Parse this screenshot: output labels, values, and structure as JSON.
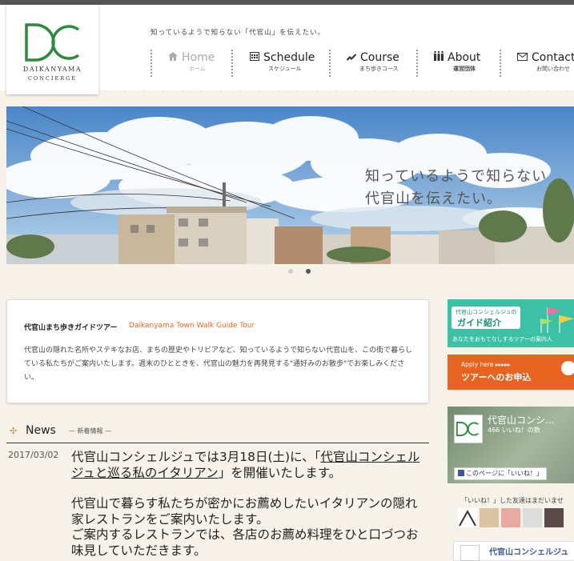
{
  "logo": {
    "line1": "DAIKANYAMA",
    "line2": "CONCIERGE",
    "color": "#2d8a3e"
  },
  "header": {
    "tagline": "知っているようで知らない「代官山」を伝えたい。"
  },
  "nav": [
    {
      "label": "Home",
      "sub": "ホーム",
      "icon": "home-icon",
      "active": true
    },
    {
      "label": "Schedule",
      "sub": "スケジュール",
      "icon": "calendar-icon"
    },
    {
      "label": "Course",
      "sub": "まち歩きコース",
      "icon": "walk-icon"
    },
    {
      "label": "About",
      "sub": "運営団体",
      "icon": "group-icon"
    },
    {
      "label": "Contact",
      "sub": "お問い合わせ",
      "icon": "mail-icon"
    }
  ],
  "hero": {
    "caption_line1": "知っているようで知らない",
    "caption_line2": "代官山を伝えたい。",
    "slide_count": 2,
    "active_slide": 2
  },
  "guide": {
    "title": "代官山まち歩きガイドツアー",
    "title_en": "Daikanyama Town Walk Guide Tour",
    "body": "代官山の隠れた名所やステキなお店、まちの歴史やトリビアなど、知っているようで知らない代官山を、この街で暮らしている私たちがご案内いたします。週末のひとときを、代官山の魅力を再発見する\"通好みのお散歩\"でお楽しみください。"
  },
  "news": {
    "title": "News",
    "subtitle": "— 新着情報 —",
    "items": [
      {
        "date": "2017/03/02",
        "text_before": "代官山コンシェルジュでは3月18日(土)に、「",
        "link": "代官山コンシェルジュと巡る私のイタリアン",
        "text_after": "」を開催いたします。",
        "para2": "代官山で暮らす私たちが密かにお薦めしたいイタリアンの隠れ家レストランをご案内いたします。",
        "para3": "ご案内するレストランでは、各店のお薦め料理をひと口づつお味見していただきます。"
      }
    ]
  },
  "sidebar": {
    "banner1_top": "代官山コンシェルジュの",
    "banner1_main": "ガイド紹介",
    "banner1_sub": "あなたをおもてなしするツアーの案内人",
    "banner1_color": "#3cc0a6",
    "banner2_top": "Apply here ▸▸▸▸▸",
    "banner2_main": "ツアーへのお申込",
    "banner2_color": "#e8631f",
    "fb_page_name": "代官山コンシ...",
    "fb_likes": "466 いいね！の数",
    "fb_like_button": "このページに「いいね！」",
    "fb_friends_text": "「いいね！」した友達はまだいませ",
    "fb_bottom_name": "代官山コンシェルジュ"
  }
}
